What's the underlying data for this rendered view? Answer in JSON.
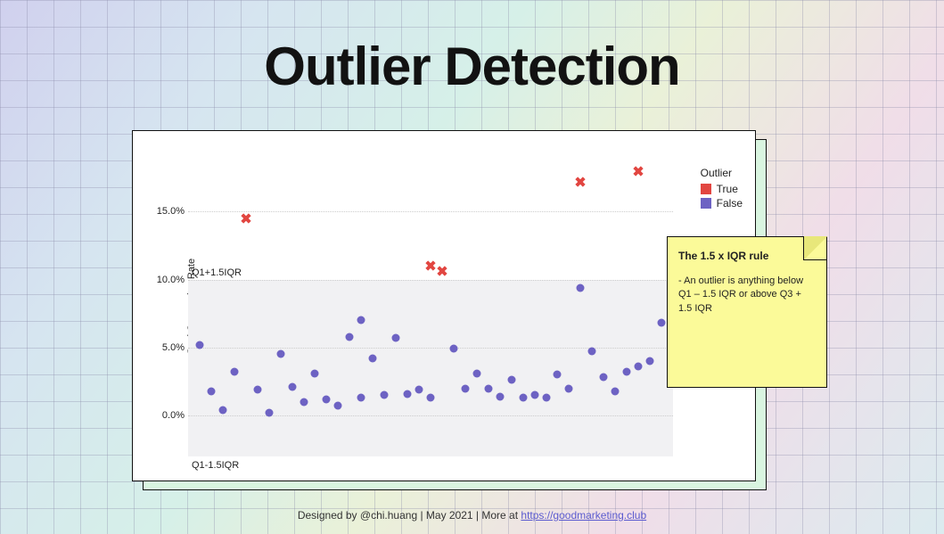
{
  "title": "Outlier Detection",
  "chart_data": {
    "type": "scatter",
    "title": "",
    "xlabel": "",
    "ylabel": "Goal Conversion Rate",
    "ylim": [
      -4,
      20
    ],
    "yticks": [
      0.0,
      5.0,
      10.0,
      15.0
    ],
    "ytick_labels": [
      "0.0%",
      "5.0%",
      "10.0%",
      "15.0%"
    ],
    "iqr_band": {
      "lower": -3.0,
      "upper": 10.0,
      "lower_label": "Q1-1.5IQR",
      "upper_label": "Q1+1.5IQR"
    },
    "series": [
      {
        "name": "False",
        "color": "#6d62c3",
        "marker": "circle",
        "points": [
          {
            "x": 1,
            "y": 5.2
          },
          {
            "x": 2,
            "y": 1.8
          },
          {
            "x": 3,
            "y": 0.4
          },
          {
            "x": 4,
            "y": 3.2
          },
          {
            "x": 6,
            "y": 1.9
          },
          {
            "x": 7,
            "y": 0.2
          },
          {
            "x": 8,
            "y": 4.5
          },
          {
            "x": 9,
            "y": 2.1
          },
          {
            "x": 10,
            "y": 1.0
          },
          {
            "x": 11,
            "y": 3.1
          },
          {
            "x": 12,
            "y": 1.2
          },
          {
            "x": 13,
            "y": 0.7
          },
          {
            "x": 14,
            "y": 5.8
          },
          {
            "x": 15,
            "y": 7.0
          },
          {
            "x": 15,
            "y": 1.3
          },
          {
            "x": 16,
            "y": 4.2
          },
          {
            "x": 17,
            "y": 1.5
          },
          {
            "x": 18,
            "y": 5.7
          },
          {
            "x": 19,
            "y": 1.6
          },
          {
            "x": 20,
            "y": 1.9
          },
          {
            "x": 21,
            "y": 1.3
          },
          {
            "x": 23,
            "y": 4.9
          },
          {
            "x": 24,
            "y": 2.0
          },
          {
            "x": 25,
            "y": 3.1
          },
          {
            "x": 26,
            "y": 2.0
          },
          {
            "x": 27,
            "y": 1.4
          },
          {
            "x": 28,
            "y": 2.6
          },
          {
            "x": 29,
            "y": 1.3
          },
          {
            "x": 30,
            "y": 1.5
          },
          {
            "x": 31,
            "y": 1.3
          },
          {
            "x": 32,
            "y": 3.0
          },
          {
            "x": 33,
            "y": 2.0
          },
          {
            "x": 34,
            "y": 9.4
          },
          {
            "x": 35,
            "y": 4.7
          },
          {
            "x": 36,
            "y": 2.8
          },
          {
            "x": 37,
            "y": 1.8
          },
          {
            "x": 38,
            "y": 3.2
          },
          {
            "x": 39,
            "y": 3.6
          },
          {
            "x": 40,
            "y": 4.0
          },
          {
            "x": 41,
            "y": 6.8
          }
        ]
      },
      {
        "name": "True",
        "color": "#e24641",
        "marker": "x",
        "points": [
          {
            "x": 5,
            "y": 14.5
          },
          {
            "x": 21,
            "y": 11.0
          },
          {
            "x": 22,
            "y": 10.6
          },
          {
            "x": 34,
            "y": 17.2
          },
          {
            "x": 39,
            "y": 18.0
          }
        ]
      }
    ],
    "legend": {
      "title": "Outlier",
      "items": [
        "True",
        "False"
      ]
    }
  },
  "note": {
    "title": "The 1.5 x IQR rule",
    "body": "- An outlier is  anything below Q1 – 1.5 IQR or above Q3 + 1.5 IQR"
  },
  "footer": {
    "prefix": "Designed by @chi.huang | May 2021 | More at ",
    "link_text": "https://goodmarketing.club",
    "link_href": "https://goodmarketing.club"
  }
}
